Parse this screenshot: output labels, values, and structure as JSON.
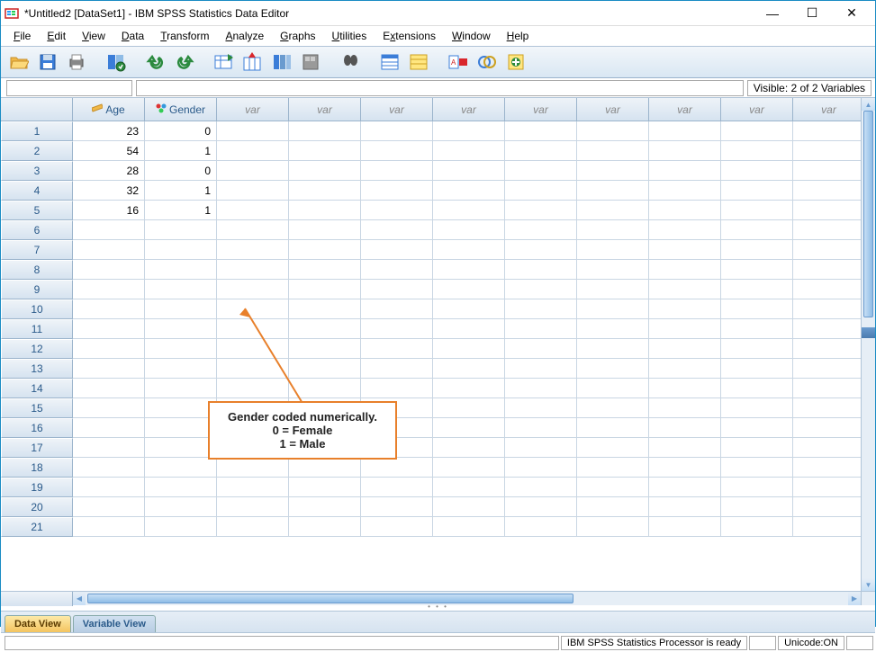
{
  "window": {
    "title": "*Untitled2 [DataSet1] - IBM SPSS Statistics Data Editor",
    "minimize": "—",
    "maximize": "☐",
    "close": "✕"
  },
  "menu": {
    "file": "File",
    "edit": "Edit",
    "view": "View",
    "data": "Data",
    "transform": "Transform",
    "analyze": "Analyze",
    "graphs": "Graphs",
    "utilities": "Utilities",
    "extensions": "Extensions",
    "window": "Window",
    "help": "Help"
  },
  "infobar": {
    "visible": "Visible: 2 of 2 Variables"
  },
  "columns": {
    "age": "Age",
    "gender": "Gender",
    "empty": "var"
  },
  "rows": [
    {
      "n": "1",
      "age": "23",
      "gender": "0"
    },
    {
      "n": "2",
      "age": "54",
      "gender": "1"
    },
    {
      "n": "3",
      "age": "28",
      "gender": "0"
    },
    {
      "n": "4",
      "age": "32",
      "gender": "1"
    },
    {
      "n": "5",
      "age": "16",
      "gender": "1"
    },
    {
      "n": "6",
      "age": "",
      "gender": ""
    },
    {
      "n": "7",
      "age": "",
      "gender": ""
    },
    {
      "n": "8",
      "age": "",
      "gender": ""
    },
    {
      "n": "9",
      "age": "",
      "gender": ""
    },
    {
      "n": "10",
      "age": "",
      "gender": ""
    },
    {
      "n": "11",
      "age": "",
      "gender": ""
    },
    {
      "n": "12",
      "age": "",
      "gender": ""
    },
    {
      "n": "13",
      "age": "",
      "gender": ""
    },
    {
      "n": "14",
      "age": "",
      "gender": ""
    },
    {
      "n": "15",
      "age": "",
      "gender": ""
    },
    {
      "n": "16",
      "age": "",
      "gender": ""
    },
    {
      "n": "17",
      "age": "",
      "gender": ""
    },
    {
      "n": "18",
      "age": "",
      "gender": ""
    },
    {
      "n": "19",
      "age": "",
      "gender": ""
    },
    {
      "n": "20",
      "age": "",
      "gender": ""
    },
    {
      "n": "21",
      "age": "",
      "gender": ""
    }
  ],
  "callout": {
    "line1": "Gender coded numerically.",
    "line2": "0 = Female",
    "line3": "1 = Male"
  },
  "tabs": {
    "data_view": "Data View",
    "variable_view": "Variable View"
  },
  "status": {
    "processor": "IBM SPSS Statistics Processor is ready",
    "unicode": "Unicode:ON"
  }
}
